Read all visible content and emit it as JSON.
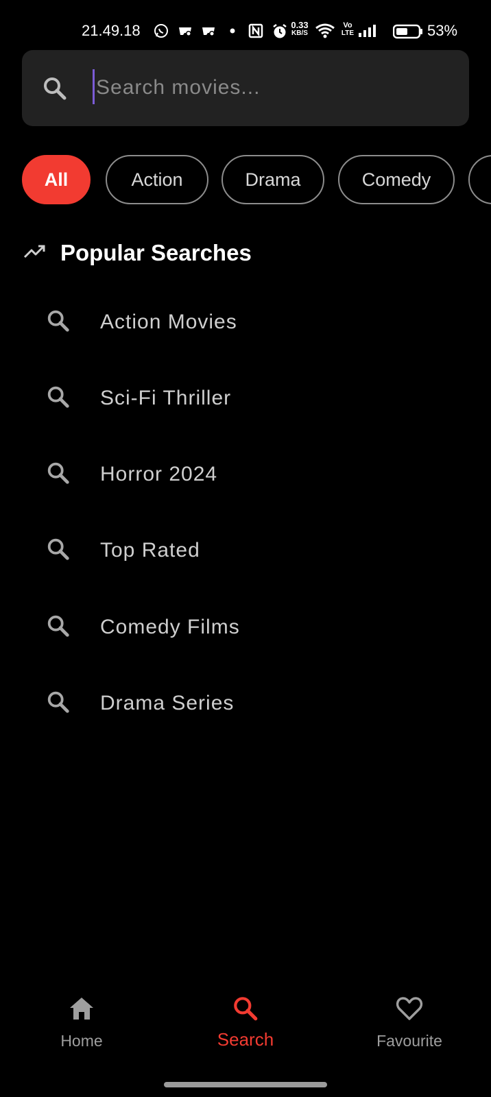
{
  "status_bar": {
    "time": "21.49.18",
    "network_speed": "0.33",
    "network_unit": "KB/S",
    "volte": "Vo",
    "lte": "LTE",
    "battery_level": 0.53,
    "battery_text": "53%"
  },
  "search": {
    "placeholder": "Search movies...",
    "value": ""
  },
  "genres": [
    {
      "label": "All",
      "active": true
    },
    {
      "label": "Action",
      "active": false
    },
    {
      "label": "Drama",
      "active": false
    },
    {
      "label": "Comedy",
      "active": false
    },
    {
      "label": "",
      "active": false
    }
  ],
  "popular": {
    "title": "Popular Searches",
    "items": [
      "Action Movies",
      "Sci-Fi Thriller",
      "Horror 2024",
      "Top Rated",
      "Comedy Films",
      "Drama Series"
    ]
  },
  "bottom_nav": {
    "items": [
      {
        "label": "Home",
        "icon": "home-icon",
        "active": false
      },
      {
        "label": "Search",
        "icon": "search-icon",
        "active": true
      },
      {
        "label": "Favourite",
        "icon": "heart-icon",
        "active": false
      }
    ]
  },
  "colors": {
    "background": "#000000",
    "accent": "#f23b31",
    "search_box": "#222222",
    "caret": "#7b5cd6"
  }
}
